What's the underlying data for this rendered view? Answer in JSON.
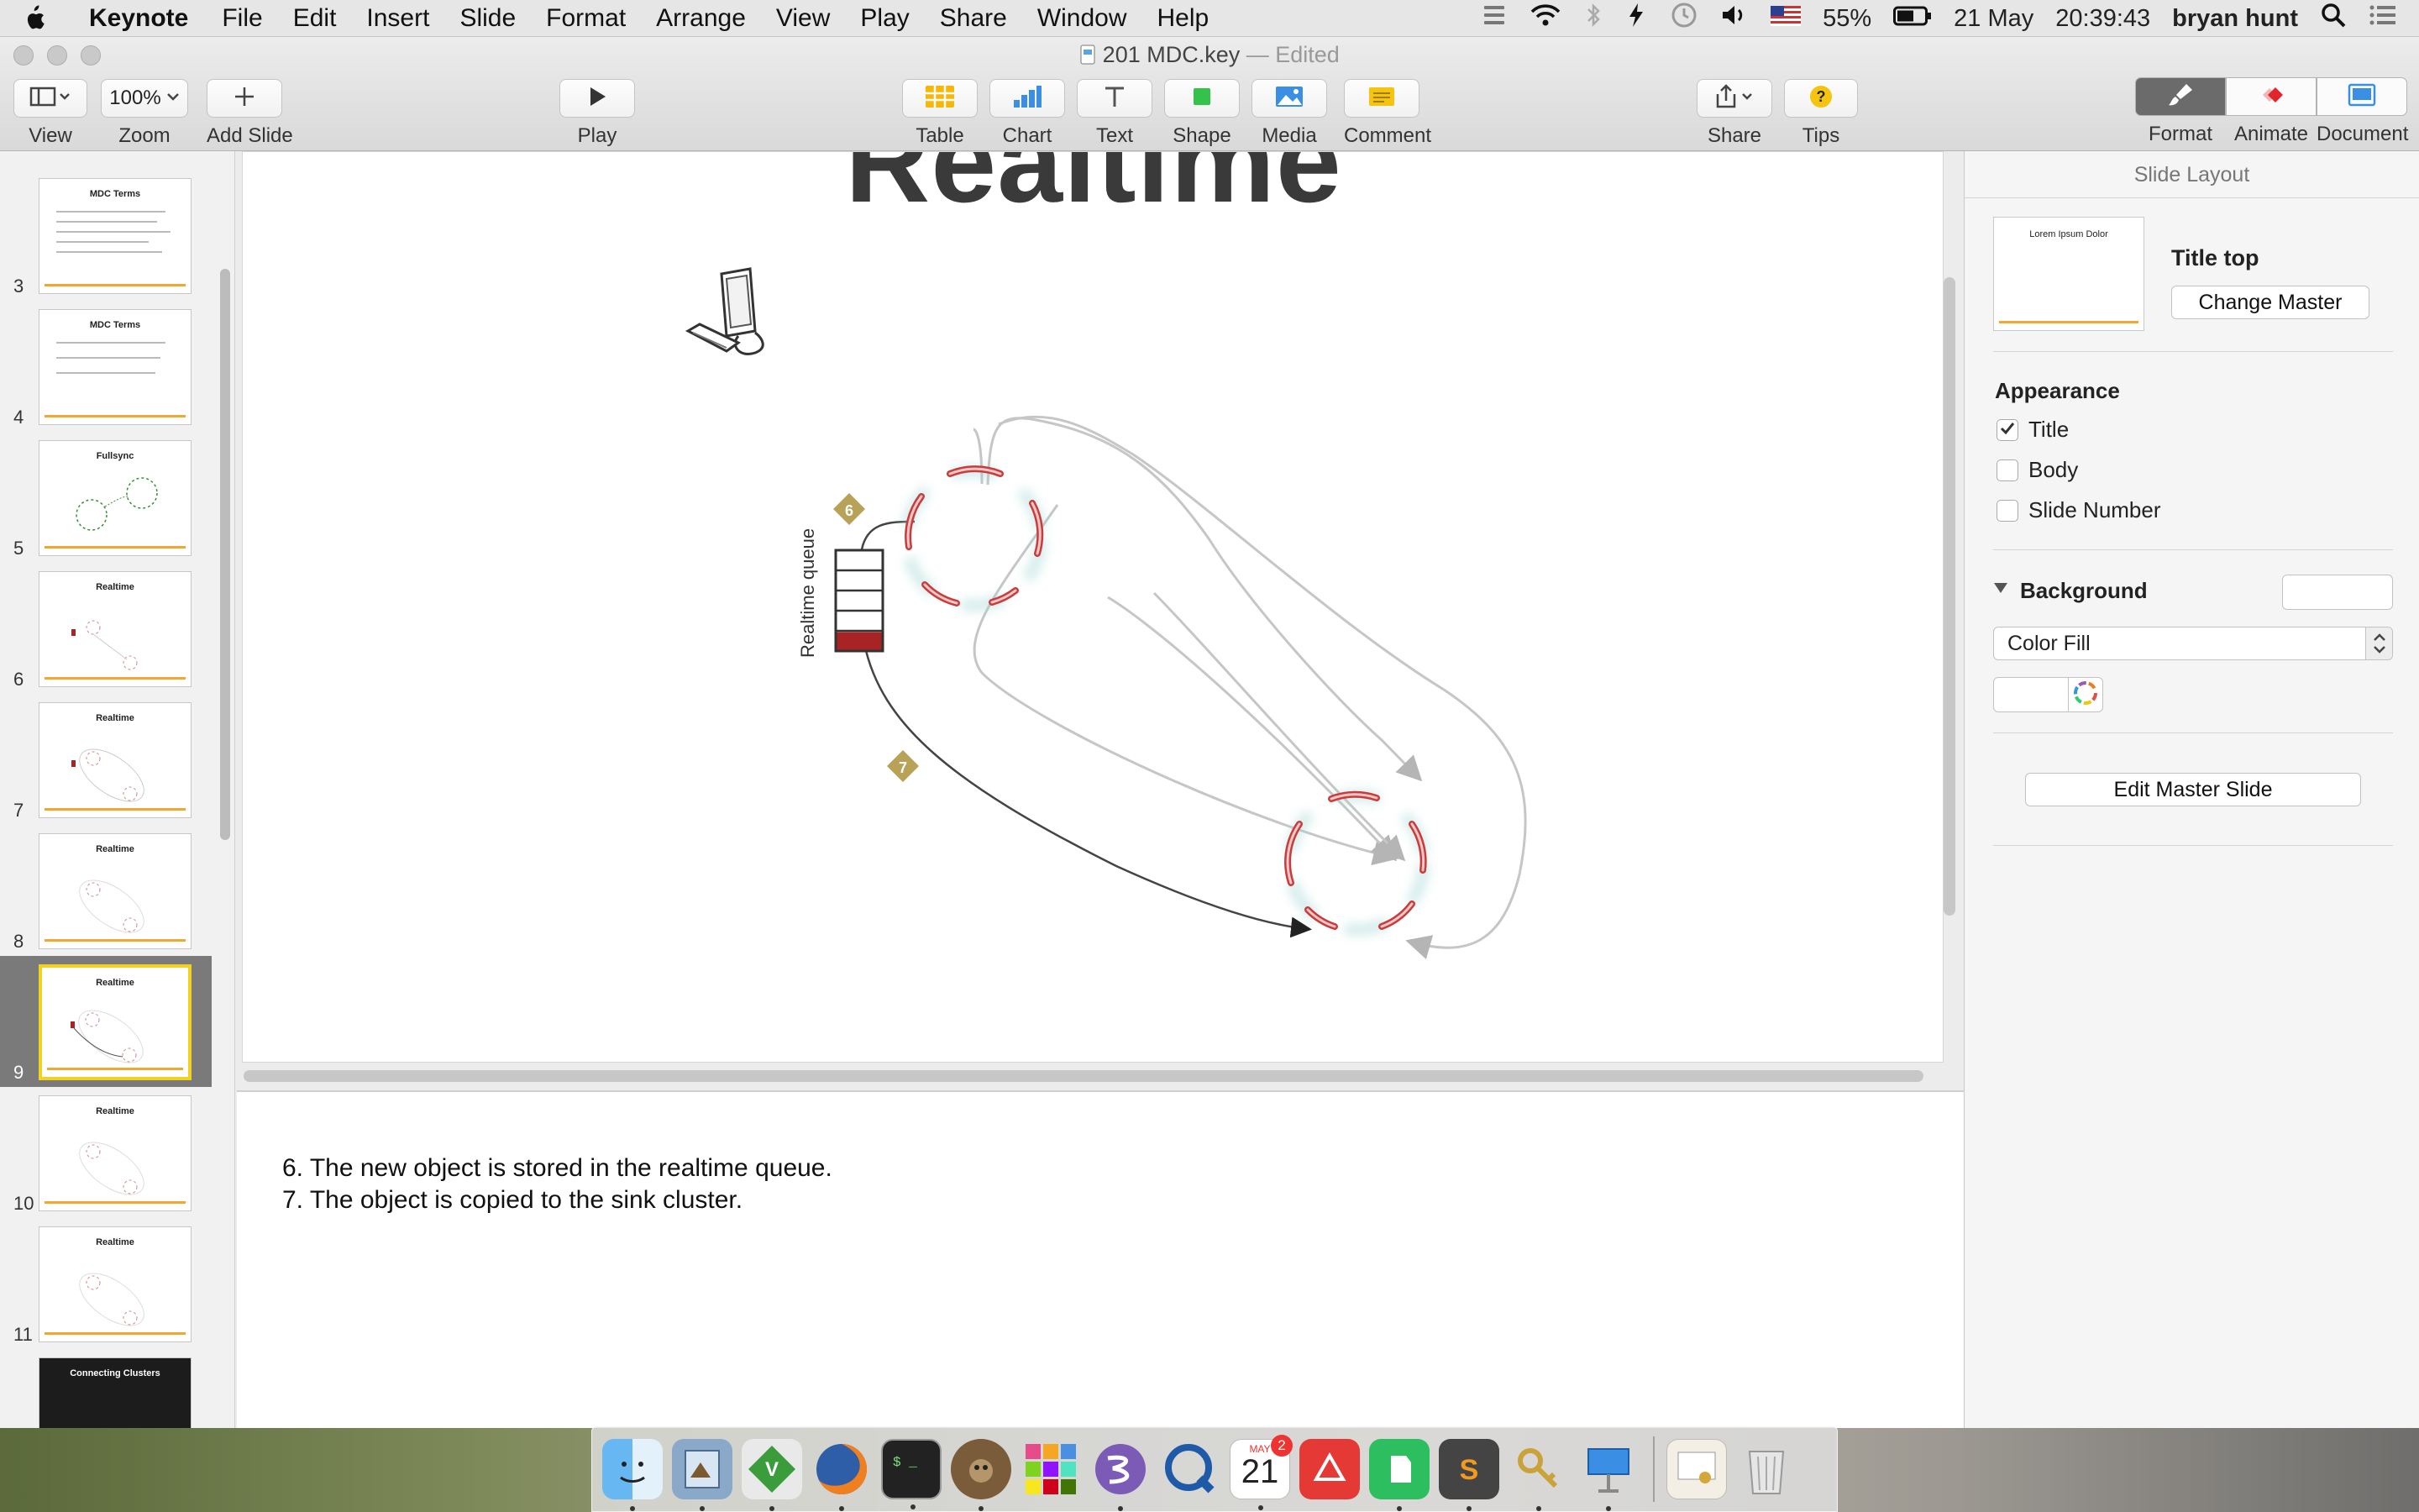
{
  "menubar": {
    "app_name": "Keynote",
    "items": [
      "File",
      "Edit",
      "Insert",
      "Slide",
      "Format",
      "Arrange",
      "View",
      "Play",
      "Share",
      "Window",
      "Help"
    ],
    "battery": "55%",
    "date": "21 May",
    "time": "20:39:43",
    "user": "bryan hunt"
  },
  "window": {
    "doc_name": "201 MDC.key",
    "doc_state": "Edited"
  },
  "toolbar": {
    "view_label": "View",
    "zoom_value": "100%",
    "zoom_label": "Zoom",
    "add_slide_label": "Add Slide",
    "play_label": "Play",
    "table_label": "Table",
    "chart_label": "Chart",
    "text_label": "Text",
    "shape_label": "Shape",
    "media_label": "Media",
    "comment_label": "Comment",
    "share_label": "Share",
    "tips_label": "Tips",
    "format_label": "Format",
    "animate_label": "Animate",
    "document_label": "Document"
  },
  "navigator": {
    "slides": [
      {
        "num": "3",
        "title": "MDC Terms",
        "selected": false
      },
      {
        "num": "4",
        "title": "MDC Terms",
        "selected": false
      },
      {
        "num": "5",
        "title": "Fullsync",
        "selected": false
      },
      {
        "num": "6",
        "title": "Realtime",
        "selected": false
      },
      {
        "num": "7",
        "title": "Realtime",
        "selected": false
      },
      {
        "num": "8",
        "title": "Realtime",
        "selected": false
      },
      {
        "num": "9",
        "title": "Realtime",
        "selected": true
      },
      {
        "num": "10",
        "title": "Realtime",
        "selected": false
      },
      {
        "num": "11",
        "title": "Realtime",
        "selected": false
      },
      {
        "num": "",
        "title": "Connecting Clusters",
        "selected": false
      }
    ]
  },
  "slide": {
    "title": "Realtime",
    "queue_label": "Realtime queue",
    "step_a": "6",
    "step_b": "7"
  },
  "notes": {
    "line1": "6. The new object is stored in the realtime queue.",
    "line2": "7. The object is copied to the sink cluster."
  },
  "inspector": {
    "header": "Slide Layout",
    "layout_thumb_text": "Lorem Ipsum Dolor",
    "master_name": "Title top",
    "change_master": "Change Master",
    "appearance_title": "Appearance",
    "opt_title": "Title",
    "opt_body": "Body",
    "opt_slide_number": "Slide Number",
    "opt_title_checked": true,
    "opt_body_checked": false,
    "opt_slide_number_checked": false,
    "background_title": "Background",
    "fill_type": "Color Fill",
    "edit_master": "Edit Master Slide"
  },
  "dock": {
    "calendar_month": "MAY",
    "calendar_day": "21",
    "calendar_badge": "2",
    "apps": [
      "finder-icon",
      "preview-icon",
      "vim-icon",
      "firefox-icon",
      "terminal-icon",
      "gimp-icon",
      "app-grid-icon",
      "emacs-icon",
      "quicktime-icon",
      "calendar-icon",
      "scrapbook-icon",
      "evernote-icon",
      "sublime-icon",
      "keychain-icon",
      "keynote-icon",
      "certificate-icon",
      "trash-icon"
    ]
  },
  "colors": {
    "accent_yellow": "#f1d21f",
    "queue_red": "#a82424",
    "step_badge": "#b8a257",
    "cluster_node": "#c83c3c"
  }
}
